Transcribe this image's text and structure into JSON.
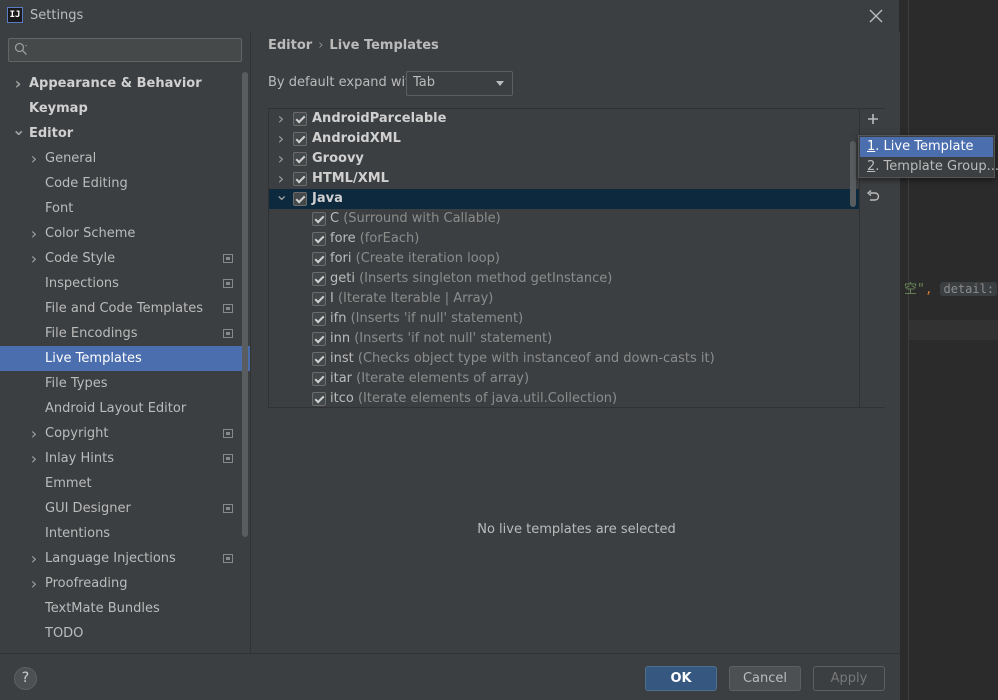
{
  "window": {
    "title": "Settings",
    "app_icon_text": "IJ"
  },
  "search": {
    "placeholder": "",
    "value": ""
  },
  "sidebar": {
    "items": [
      {
        "label": "Appearance & Behavior",
        "level": 0,
        "chevron": "right",
        "bold": true
      },
      {
        "label": "Keymap",
        "level": 0,
        "chevron": "",
        "bold": true
      },
      {
        "label": "Editor",
        "level": 0,
        "chevron": "down",
        "bold": true
      },
      {
        "label": "General",
        "level": 1,
        "chevron": "right"
      },
      {
        "label": "Code Editing",
        "level": 1,
        "chevron": ""
      },
      {
        "label": "Font",
        "level": 1,
        "chevron": ""
      },
      {
        "label": "Color Scheme",
        "level": 1,
        "chevron": "right"
      },
      {
        "label": "Code Style",
        "level": 1,
        "chevron": "right",
        "project_icon": true
      },
      {
        "label": "Inspections",
        "level": 1,
        "chevron": "",
        "project_icon": true
      },
      {
        "label": "File and Code Templates",
        "level": 1,
        "chevron": "",
        "project_icon": true
      },
      {
        "label": "File Encodings",
        "level": 1,
        "chevron": "",
        "project_icon": true
      },
      {
        "label": "Live Templates",
        "level": 1,
        "chevron": "",
        "selected": true
      },
      {
        "label": "File Types",
        "level": 1,
        "chevron": ""
      },
      {
        "label": "Android Layout Editor",
        "level": 1,
        "chevron": ""
      },
      {
        "label": "Copyright",
        "level": 1,
        "chevron": "right",
        "project_icon": true
      },
      {
        "label": "Inlay Hints",
        "level": 1,
        "chevron": "right",
        "project_icon": true
      },
      {
        "label": "Emmet",
        "level": 1,
        "chevron": ""
      },
      {
        "label": "GUI Designer",
        "level": 1,
        "chevron": "",
        "project_icon": true
      },
      {
        "label": "Intentions",
        "level": 1,
        "chevron": ""
      },
      {
        "label": "Language Injections",
        "level": 1,
        "chevron": "right",
        "project_icon": true
      },
      {
        "label": "Proofreading",
        "level": 1,
        "chevron": "right"
      },
      {
        "label": "TextMate Bundles",
        "level": 1,
        "chevron": ""
      },
      {
        "label": "TODO",
        "level": 1,
        "chevron": ""
      }
    ]
  },
  "breadcrumb": {
    "parent": "Editor",
    "separator": "›",
    "current": "Live Templates"
  },
  "expand": {
    "label": "By default expand with",
    "value": "Tab"
  },
  "template_groups": [
    {
      "name": "AndroidParcelable",
      "expanded": false,
      "checked": true
    },
    {
      "name": "AndroidXML",
      "expanded": false,
      "checked": true
    },
    {
      "name": "Groovy",
      "expanded": false,
      "checked": true
    },
    {
      "name": "HTML/XML",
      "expanded": false,
      "checked": true
    },
    {
      "name": "Java",
      "expanded": true,
      "checked": true,
      "selected": true,
      "templates": [
        {
          "abbr": "C",
          "desc": "(Surround with Callable)"
        },
        {
          "abbr": "fore",
          "desc": "(forEach)"
        },
        {
          "abbr": "fori",
          "desc": "(Create iteration loop)"
        },
        {
          "abbr": "geti",
          "desc": "(Inserts singleton method getInstance)"
        },
        {
          "abbr": "I",
          "desc": "(Iterate Iterable | Array)"
        },
        {
          "abbr": "ifn",
          "desc": "(Inserts 'if null' statement)"
        },
        {
          "abbr": "inn",
          "desc": "(Inserts 'if not null' statement)"
        },
        {
          "abbr": "inst",
          "desc": "(Checks object type with instanceof and down-casts it)"
        },
        {
          "abbr": "itar",
          "desc": "(Iterate elements of array)"
        },
        {
          "abbr": "itco",
          "desc": "(Iterate elements of java.util.Collection)"
        }
      ]
    }
  ],
  "tools": {
    "add": "+",
    "revert": "↶"
  },
  "popup": {
    "items": [
      {
        "mnemonic": "1",
        "rest": ". Live Template",
        "selected": true
      },
      {
        "mnemonic": "2",
        "rest": ". Template Group..."
      }
    ]
  },
  "empty_message": "No live templates are selected",
  "footer": {
    "help": "?",
    "ok": "OK",
    "cancel": "Cancel",
    "apply": "Apply"
  },
  "background_code": {
    "text": "空\"",
    "comma": ",",
    "hint": "detail:",
    "tail": "\"\""
  },
  "colors": {
    "accent": "#4b6eaf",
    "background": "#3c3f41",
    "selected_row": "#0d293e",
    "ok_button": "#365880"
  }
}
